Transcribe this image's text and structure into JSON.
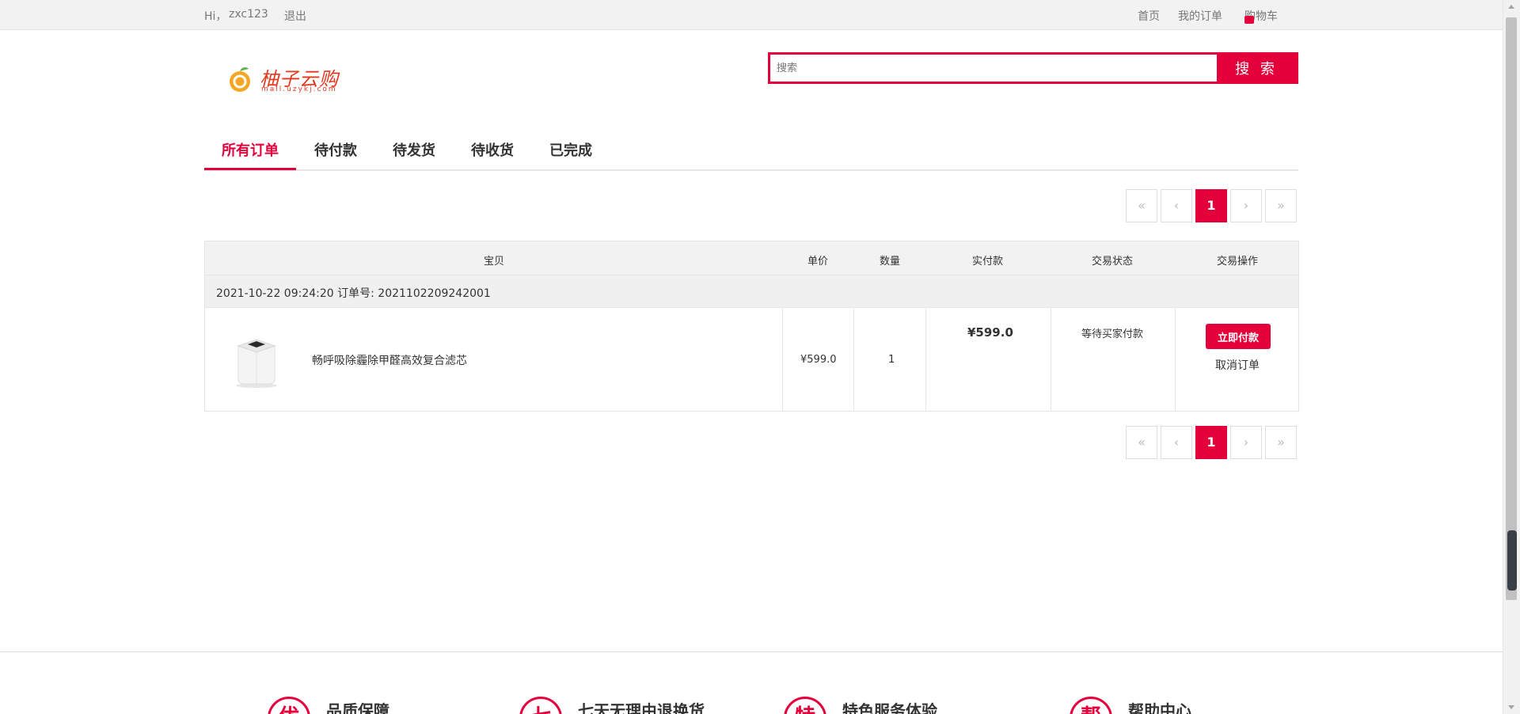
{
  "topbar": {
    "greeting": "Hi，",
    "username": "zxc123",
    "logout": "退出",
    "home": "首页",
    "my_orders": "我的订单",
    "cart": "购物车"
  },
  "logo": {
    "name": "柚子云购",
    "domain": "mall.uzykj.com"
  },
  "search": {
    "placeholder": "搜索",
    "button": "搜 索"
  },
  "tabs": [
    "所有订单",
    "待付款",
    "待发货",
    "待收货",
    "已完成"
  ],
  "active_tab": "所有订单",
  "pagination": {
    "first": "«",
    "prev": "‹",
    "current": "1",
    "next": "›",
    "last": "»"
  },
  "table": {
    "headers": [
      "宝贝",
      "单价",
      "数量",
      "实付款",
      "交易状态",
      "交易操作"
    ]
  },
  "order": {
    "header": "2021-10-22 09:24:20 订单号: 2021102209242001",
    "product_name": "畅呼吸除霾除甲醛高效复合滤芯",
    "unit_price": "¥599.0",
    "quantity": "1",
    "paid": "¥599.0",
    "status": "等待买家付款",
    "pay_button": "立即付款",
    "cancel": "取消订单"
  },
  "footer": {
    "items": [
      {
        "icon_char": "优",
        "label": "品质保障"
      },
      {
        "icon_char": "七",
        "label": "七天无理由退换货"
      },
      {
        "icon_char": "特",
        "label": "特色服务体验"
      },
      {
        "icon_char": "帮",
        "label": "帮助中心"
      }
    ]
  },
  "colors": {
    "accent": "#e4003a",
    "topbar_bg": "#f2f2f2"
  }
}
